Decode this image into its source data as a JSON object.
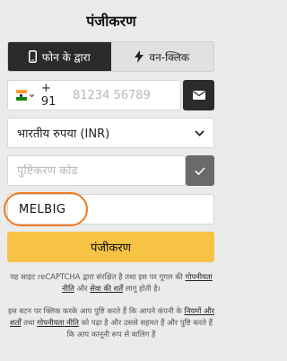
{
  "page_title": "पंजीकरण",
  "tabs": [
    {
      "label": "फोन के द्वारा",
      "icon": "mobile-phone-icon",
      "active": true
    },
    {
      "label": "वन-क्लिक",
      "icon": "lightning-icon",
      "active": false
    }
  ],
  "phone": {
    "country_code": "+ 91",
    "placeholder": "81234 56789",
    "flag_colors": [
      "#ff9933",
      "#ffffff",
      "#138808"
    ]
  },
  "email_button_icon": "envelope-icon",
  "currency": {
    "selected": "भारतीय रुपया (INR)"
  },
  "promo": {
    "placeholder": "पुष्टिकरण कोड"
  },
  "promo_code": {
    "value": "MELBIG"
  },
  "register_label": "पंजीकरण",
  "recaptcha_note": {
    "prefix": "यह साइट reCAPTCHA द्वारा संरक्षित है तथा इस पर गूगल की",
    "privacy_link": "गोपनीयता नीति",
    "and": "और",
    "terms_link": "सेवा की शर्तें",
    "suffix": "लागू होती है।"
  },
  "consent_note": {
    "prefix": "इस बटन पर क्लिक करके आप पुष्टि करते हैं कि आपने कंपनी के",
    "terms_link": "नियमों और शर्तों",
    "mid": "तथा",
    "privacy_link": "गोपनीयता नीति",
    "suffix": "को पढ़ा है और उससे सहमत हैं और पुष्टि करते हैं कि आप कानूनी रूप से बालिग हैं"
  },
  "colors": {
    "accent": "#f6c344",
    "dark": "#2b2b2b",
    "highlight": "#f07a20"
  }
}
